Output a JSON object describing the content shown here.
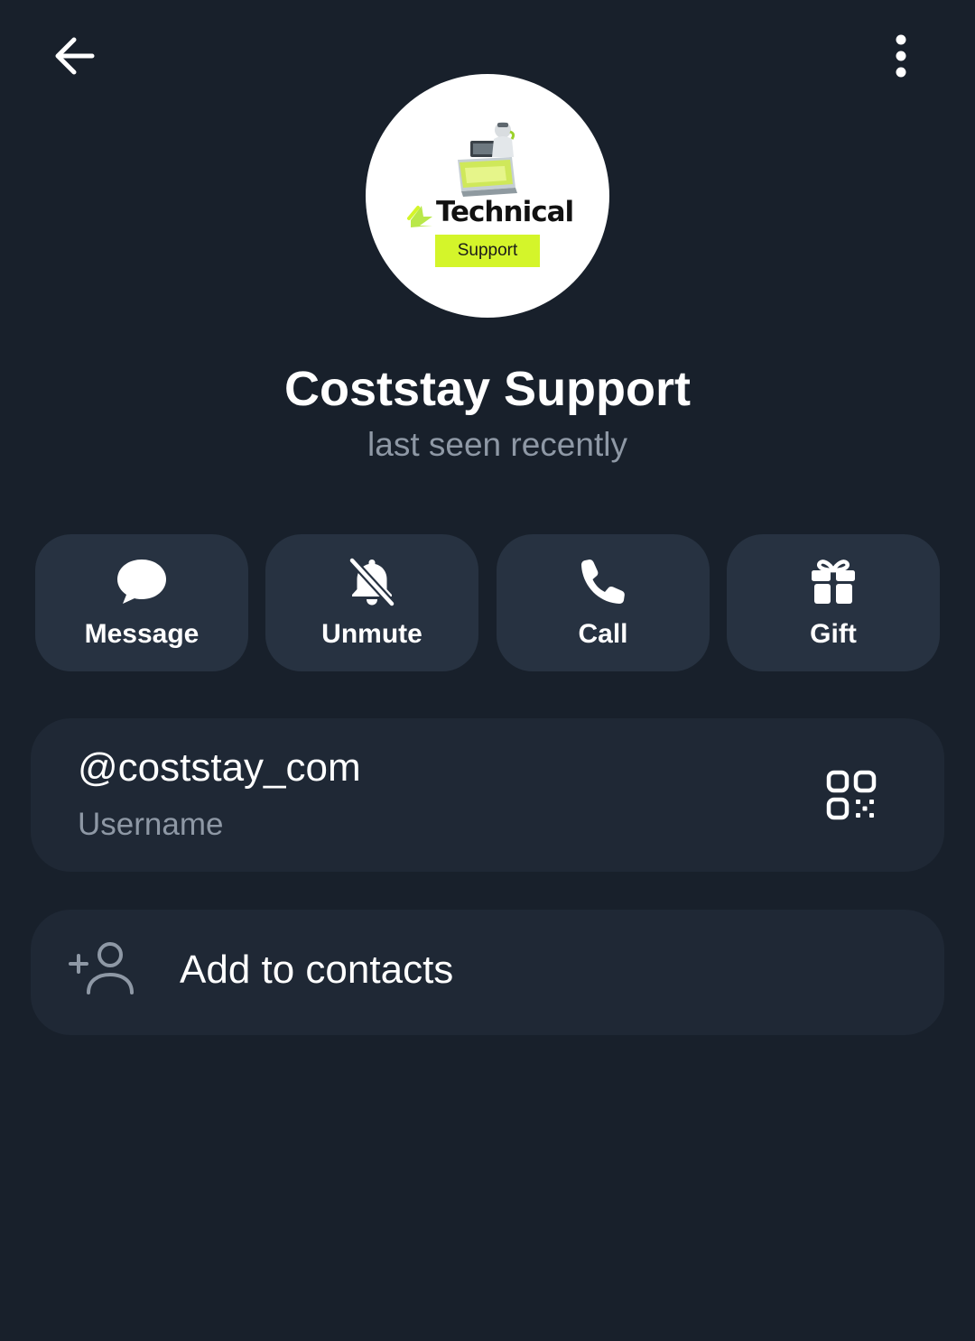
{
  "header": {
    "back_icon": "arrow-left-icon",
    "menu_icon": "more-vertical-icon"
  },
  "profile": {
    "avatar_logo_text": "Technical",
    "avatar_logo_badge": "Support",
    "name": "Coststay Support",
    "status": "last seen recently"
  },
  "actions": [
    {
      "label": "Message",
      "icon": "message-bubble-icon"
    },
    {
      "label": "Unmute",
      "icon": "bell-off-icon"
    },
    {
      "label": "Call",
      "icon": "phone-icon"
    },
    {
      "label": "Gift",
      "icon": "gift-icon"
    }
  ],
  "username": {
    "value": "@coststay_com",
    "label": "Username",
    "qr_icon": "qr-code-icon"
  },
  "add_contact": {
    "label": "Add to contacts",
    "icon": "add-person-icon"
  },
  "colors": {
    "background": "#18202b",
    "action_button": "#273241",
    "card": "#1f2835",
    "secondary_text": "#8e98a5",
    "logo_accent": "#d4f52a"
  }
}
